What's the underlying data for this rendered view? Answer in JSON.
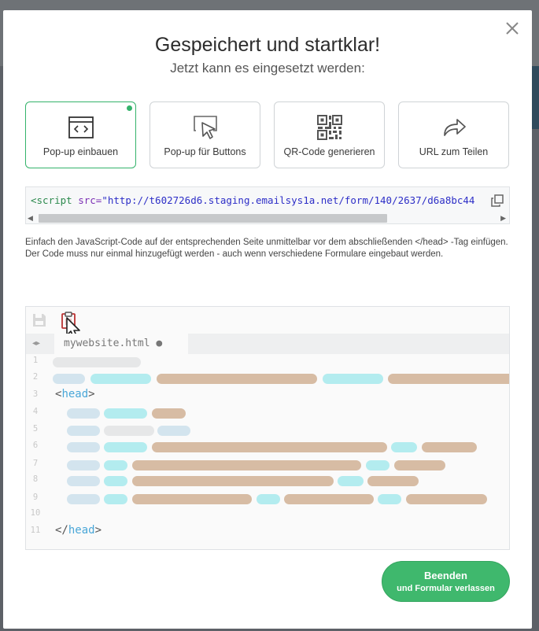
{
  "dialog": {
    "title": "Gespeichert und startklar!",
    "subtitle": "Jetzt kann es eingesetzt werden:"
  },
  "options": [
    {
      "label": "Pop-up einbauen",
      "icon": "browser-code-icon",
      "active": true
    },
    {
      "label": "Pop-up für Buttons",
      "icon": "cursor-click-icon",
      "active": false
    },
    {
      "label": "QR-Code generieren",
      "icon": "qr-code-icon",
      "active": false
    },
    {
      "label": "URL zum Teilen",
      "icon": "share-arrow-icon",
      "active": false
    }
  ],
  "embed": {
    "tag_open": "<script",
    "attr": " src=",
    "value": "\"http://t602726d6.staging.emailsys1a.net/form/140/2637/d6a8bc44"
  },
  "help_text": "Einfach den JavaScript-Code auf der entsprechenden Seite unmittelbar vor dem abschließenden </head> -Tag einfügen. Der Code muss nur einmal hinzugefügt werden - auch wenn verschiedene Formulare eingebaut werden.",
  "editor": {
    "tab_filename": "mywebsite.html ●",
    "line_numbers": [
      "1",
      "2",
      "3",
      "4",
      "5",
      "6",
      "7",
      "8",
      "9",
      "10",
      "11"
    ],
    "head_open_lt": "<",
    "head_open_kw": "head",
    "head_open_gt": ">",
    "head_close_lt": "</",
    "head_close_kw": "head",
    "head_close_gt": ">"
  },
  "finish_button": {
    "line1": "Beenden",
    "line2": "und Formular verlassen"
  },
  "colors": {
    "accent_green": "#3fb86d",
    "bar_cyan": "#b3ecef",
    "bar_tan": "#d7bca4",
    "bar_blue": "#d3e4ee"
  }
}
